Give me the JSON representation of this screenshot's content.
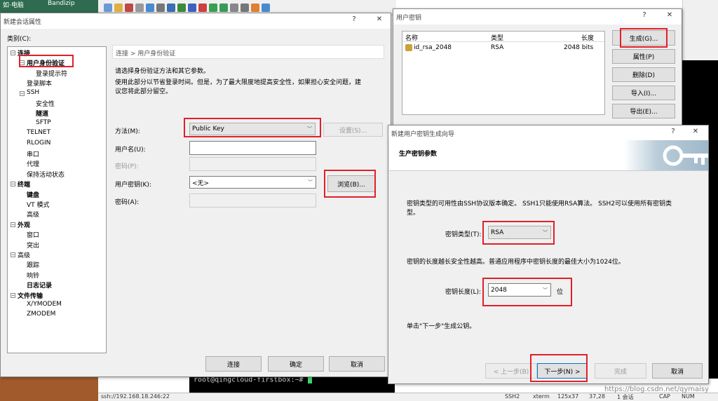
{
  "desktop": {
    "icon_labels": [
      "如·电脑",
      "Bandizip"
    ]
  },
  "session_dialog": {
    "title": "新建会话属性",
    "help_btn": "?",
    "close_btn": "✕",
    "category_label": "类别(C):",
    "tree": [
      {
        "label": "连接",
        "bold": true,
        "level": 0
      },
      {
        "label": "用户身份验证",
        "bold": true,
        "level": 1
      },
      {
        "label": "登录提示符",
        "bold": false,
        "level": 2
      },
      {
        "label": "登录脚本",
        "bold": false,
        "level": 1
      },
      {
        "label": "SSH",
        "bold": false,
        "level": 1
      },
      {
        "label": "安全性",
        "bold": false,
        "level": 2
      },
      {
        "label": "隧道",
        "bold": true,
        "level": 2
      },
      {
        "label": "SFTP",
        "bold": false,
        "level": 2
      },
      {
        "label": "TELNET",
        "bold": false,
        "level": 1
      },
      {
        "label": "RLOGIN",
        "bold": false,
        "level": 1
      },
      {
        "label": "串口",
        "bold": false,
        "level": 1
      },
      {
        "label": "代理",
        "bold": false,
        "level": 1
      },
      {
        "label": "保持活动状态",
        "bold": false,
        "level": 1
      },
      {
        "label": "终端",
        "bold": true,
        "level": 0
      },
      {
        "label": "键盘",
        "bold": true,
        "level": 1
      },
      {
        "label": "VT 模式",
        "bold": false,
        "level": 1
      },
      {
        "label": "高级",
        "bold": false,
        "level": 1
      },
      {
        "label": "外观",
        "bold": true,
        "level": 0
      },
      {
        "label": "窗口",
        "bold": false,
        "level": 1
      },
      {
        "label": "突出",
        "bold": false,
        "level": 1
      },
      {
        "label": "高级",
        "bold": false,
        "level": 0
      },
      {
        "label": "跟踪",
        "bold": false,
        "level": 1
      },
      {
        "label": "响铃",
        "bold": false,
        "level": 1
      },
      {
        "label": "日志记录",
        "bold": true,
        "level": 1
      },
      {
        "label": "文件传输",
        "bold": true,
        "level": 0
      },
      {
        "label": "X/YMODEM",
        "bold": false,
        "level": 1
      },
      {
        "label": "ZMODEM",
        "bold": false,
        "level": 1
      }
    ],
    "breadcrumb": "连接 > 用户身份验证",
    "desc1": "请选择身份验证方法和其它参数。",
    "desc2": "使用此部分以节省登录时间。但是，为了最大限度地提高安全性，如果担心安全问题，建",
    "desc3": "议您将此部分留空。",
    "method_label": "方法(M):",
    "method_value": "Public Key",
    "settings_btn": "设置(S)...",
    "username_label": "用户名(U):",
    "username_value": "",
    "password_label": "密码(P):",
    "userkey_label": "用户密钥(K):",
    "userkey_value": "<无>",
    "browse_btn": "浏览(B)...",
    "passphrase_label": "密码(A):",
    "connect_btn": "连接",
    "ok_btn": "确定",
    "cancel_btn": "取消"
  },
  "userkey_dialog": {
    "title": "用户密钥",
    "help_btn": "?",
    "close_btn": "✕",
    "columns": [
      "名称",
      "类型",
      "长度"
    ],
    "rows": [
      {
        "name": "id_rsa_2048",
        "type": "RSA",
        "length": "2048 bits"
      }
    ],
    "generate_btn": "生成(G)...",
    "properties_btn": "属性(P)",
    "delete_btn": "删除(D)",
    "import_btn": "导入(I)...",
    "export_btn": "导出(E)..."
  },
  "wizard": {
    "title": "新建用户密钥生成向导",
    "help_btn": "?",
    "close_btn": "✕",
    "header": "生产密钥参数",
    "text1a": "密钥类型的可用性由SSH协议版本确定。 SSH1只能使用RSA算法。 SSH2可以使用所有密钥类",
    "text1b": "型。",
    "keytype_label": "密钥类型(T):",
    "keytype_value": "RSA",
    "text2": "密钥的长度越长安全性越高。普通应用程序中密钥长度的最佳大小为1024位。",
    "keylen_label": "密钥长度(L):",
    "keylen_value": "2048",
    "keylen_unit": "位",
    "text3": "单击\"下一步\"生成公钥。",
    "back_btn": "< 上一步(B)",
    "next_btn": "下一步(N) >",
    "finish_btn": "完成",
    "cancel_btn": "取消"
  },
  "terminal": {
    "prompt": "root@qingcloud-firstbox:~# "
  },
  "statusbar": {
    "left": "ssh://192.168.18.246:22",
    "items": [
      "SSH2",
      "xterm",
      "125x37",
      "37,28",
      "1 会话",
      "CAP",
      "NUM"
    ],
    "watermark": "https://blog.csdn.net/qymaisy"
  },
  "colors": {
    "highlight": "#e0202a",
    "terminal_bg": "#000000",
    "accent": "#0078d7"
  }
}
